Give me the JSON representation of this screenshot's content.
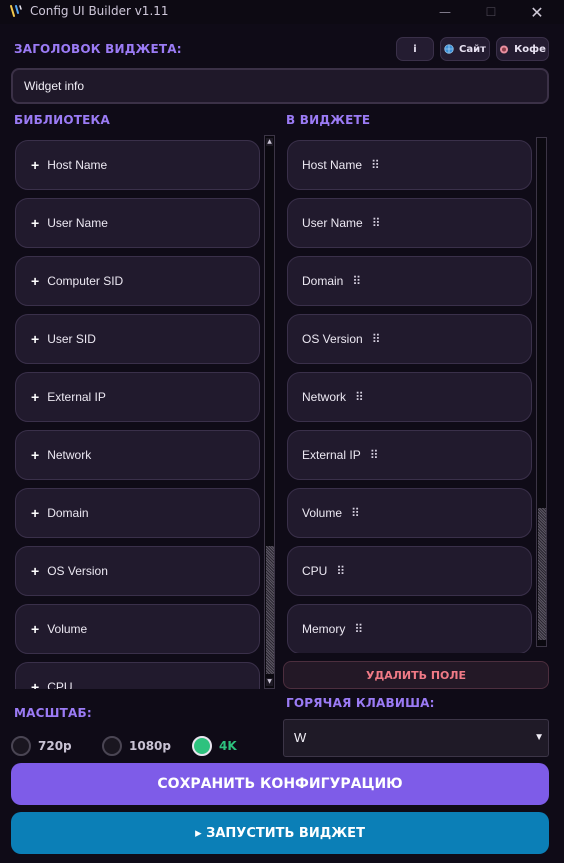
{
  "window": {
    "title": "Config UI Builder v1.11",
    "minimize_glyph": "—",
    "maximize_glyph": "☐",
    "close_glyph": "✕"
  },
  "header": {
    "widget_title_label": "ЗАГОЛОВОК ВИДЖЕТА:",
    "info_button": "i",
    "site_button": "Сайт",
    "coffee_button": "Кофе"
  },
  "widget_title_input": {
    "value": "Widget info"
  },
  "library": {
    "label": "БИБЛИОТЕКА",
    "items": [
      "Host Name",
      "User Name",
      "Computer SID",
      "User SID",
      "External IP",
      "Network",
      "Domain",
      "OS Version",
      "Volume",
      "CPU"
    ]
  },
  "in_widget": {
    "label": "В ВИДЖЕТЕ",
    "items": [
      "Host Name",
      "User Name",
      "Domain",
      "OS Version",
      "Network",
      "External IP",
      "Volume",
      "CPU",
      "Memory"
    ]
  },
  "delete_button": "УДАЛИТЬ ПОЛЕ",
  "scale": {
    "label": "МАСШТАБ:",
    "options": [
      "720p",
      "1080p",
      "4K"
    ],
    "selected": "4K"
  },
  "hotkey": {
    "label": "ГОРЯЧАЯ КЛАВИША:",
    "value": "W"
  },
  "save_button": "СОХРАНИТЬ КОНФИГУРАЦИЮ",
  "launch_button": "▸ ЗАПУСТИТЬ ВИДЖЕТ",
  "colors": {
    "accent": "#9b7bf5",
    "save": "#7e5ce8",
    "launch": "#0b7fb7",
    "selected_radio": "#2ec27e",
    "delete_text": "#f07a86"
  }
}
